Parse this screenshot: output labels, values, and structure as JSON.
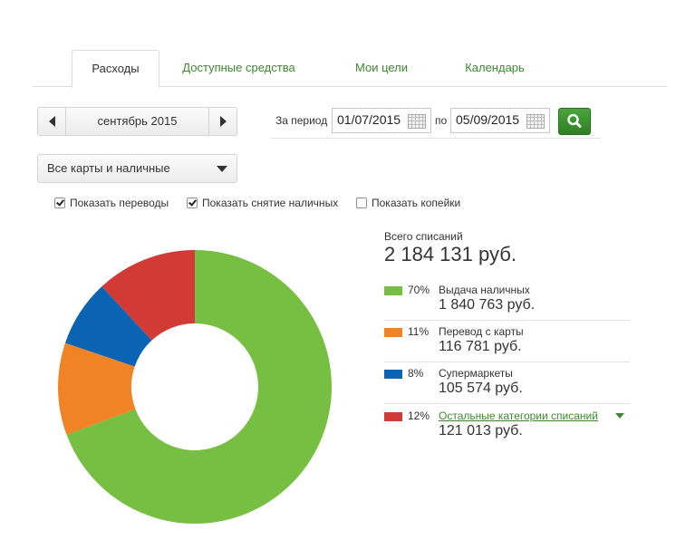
{
  "tabs": [
    {
      "label": "Расходы"
    },
    {
      "label": "Доступные средства"
    },
    {
      "label": "Мои цели"
    },
    {
      "label": "Календарь"
    }
  ],
  "month_nav": {
    "label": "сентябрь 2015"
  },
  "period": {
    "label": "За период",
    "from": "01/07/2015",
    "to_label": "по",
    "to": "05/09/2015"
  },
  "card_select": {
    "selected": "Все карты и наличные"
  },
  "checkboxes": [
    {
      "label": "Показать переводы",
      "checked": true
    },
    {
      "label": "Показать снятие наличных",
      "checked": true
    },
    {
      "label": "Показать копейки",
      "checked": false
    }
  ],
  "summary": {
    "total_label": "Всего списаний",
    "total_value": "2 184 131 руб."
  },
  "legend": [
    {
      "pct": "70%",
      "name": "Выдача наличных",
      "amount": "1 840 763 руб.",
      "color": "#76bf43"
    },
    {
      "pct": "11%",
      "name": "Перевод с карты",
      "amount": "116 781 руб.",
      "color": "#f08326"
    },
    {
      "pct": "8%",
      "name": "Супермаркеты",
      "amount": "105 574 руб.",
      "color": "#0b63b3"
    },
    {
      "pct": "12%",
      "name": "Остальные категории списаний",
      "amount": "121 013 руб.",
      "color": "#d23a35"
    }
  ],
  "chart_data": {
    "type": "pie",
    "donut": true,
    "categories": [
      "Выдача наличных",
      "Перевод с карты",
      "Супермаркеты",
      "Остальные категории списаний"
    ],
    "values": [
      70,
      11,
      8,
      12
    ],
    "colors": [
      "#76bf43",
      "#f08326",
      "#0b63b3",
      "#d23a35"
    ]
  }
}
